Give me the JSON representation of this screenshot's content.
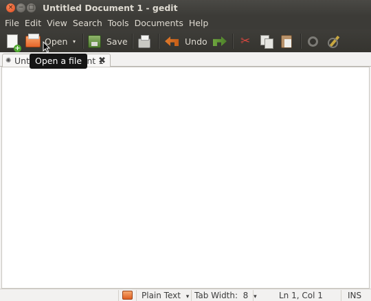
{
  "window": {
    "title": "Untitled Document 1 - gedit",
    "controls": {
      "close": "×",
      "minimize": "−",
      "maximize": "□"
    }
  },
  "menubar": {
    "items": [
      "File",
      "Edit",
      "View",
      "Search",
      "Tools",
      "Documents",
      "Help"
    ]
  },
  "toolbar": {
    "new_icon": "new-document-icon",
    "open_label": "Open",
    "open_dropdown": "▾",
    "save_label": "Save",
    "print_icon": "printer-icon",
    "undo_label": "Undo",
    "redo_icon": "redo-icon",
    "cut_icon": "scissors-icon",
    "copy_icon": "copy-icon",
    "paste_icon": "paste-icon",
    "find_icon": "find-icon",
    "replace_icon": "find-replace-icon"
  },
  "tooltip": {
    "text": "Open a file"
  },
  "tabs": [
    {
      "label": "Untitled Document 1",
      "close": "✖"
    }
  ],
  "statusbar": {
    "language": "Plain Text",
    "language_arrow": "▾",
    "tab_width": "Tab Width:  8",
    "tab_width_arrow": "▾",
    "position": "Ln 1, Col 1",
    "mode": "INS"
  },
  "colors": {
    "titlebar": "#3c3b37",
    "close_button": "#e0491c",
    "tooltip_bg": "#151515",
    "window_bg": "#f2f1f0"
  }
}
